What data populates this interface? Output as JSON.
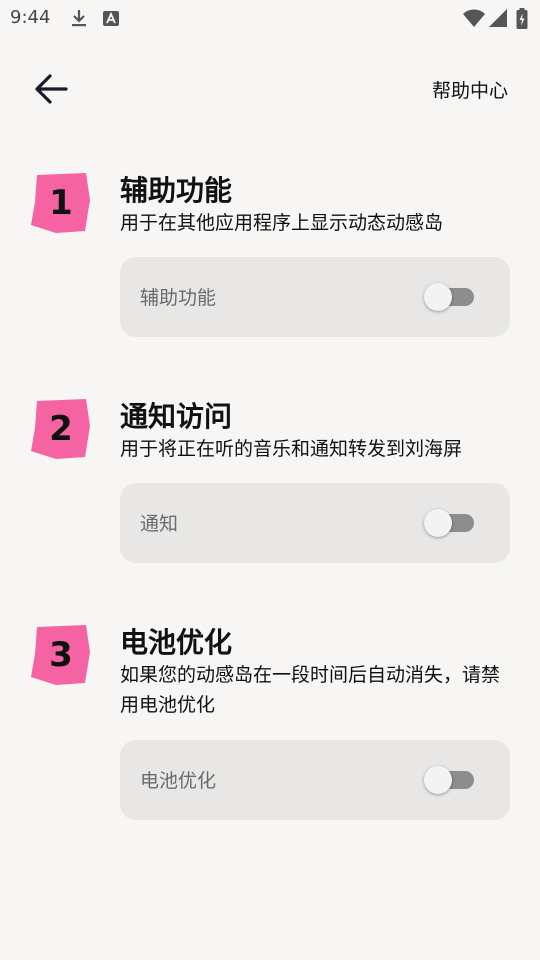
{
  "status_bar": {
    "time": "9:44",
    "left_icons": [
      "download-icon",
      "font-app-icon"
    ],
    "right_icons": [
      "wifi-icon",
      "cellular-signal-icon",
      "battery-icon"
    ]
  },
  "app_bar": {
    "back_icon": "arrow-back-icon",
    "help_label": "帮助中心"
  },
  "colors": {
    "background": "#f7f6f4",
    "badge": "#f563a3",
    "card": "#e8e7e5",
    "switch_track_off": "#8d8d8d"
  },
  "sections": [
    {
      "number": "1",
      "title": "辅助功能",
      "description": "用于在其他应用程序上显示动态动感岛",
      "toggle_label": "辅助功能",
      "toggle_on": false
    },
    {
      "number": "2",
      "title": "通知访问",
      "description": "用于将正在听的音乐和通知转发到刘海屏",
      "toggle_label": "通知",
      "toggle_on": false
    },
    {
      "number": "3",
      "title": "电池优化",
      "description": "如果您的动感岛在一段时间后自动消失，请禁用电池优化",
      "toggle_label": "电池优化",
      "toggle_on": false
    }
  ]
}
